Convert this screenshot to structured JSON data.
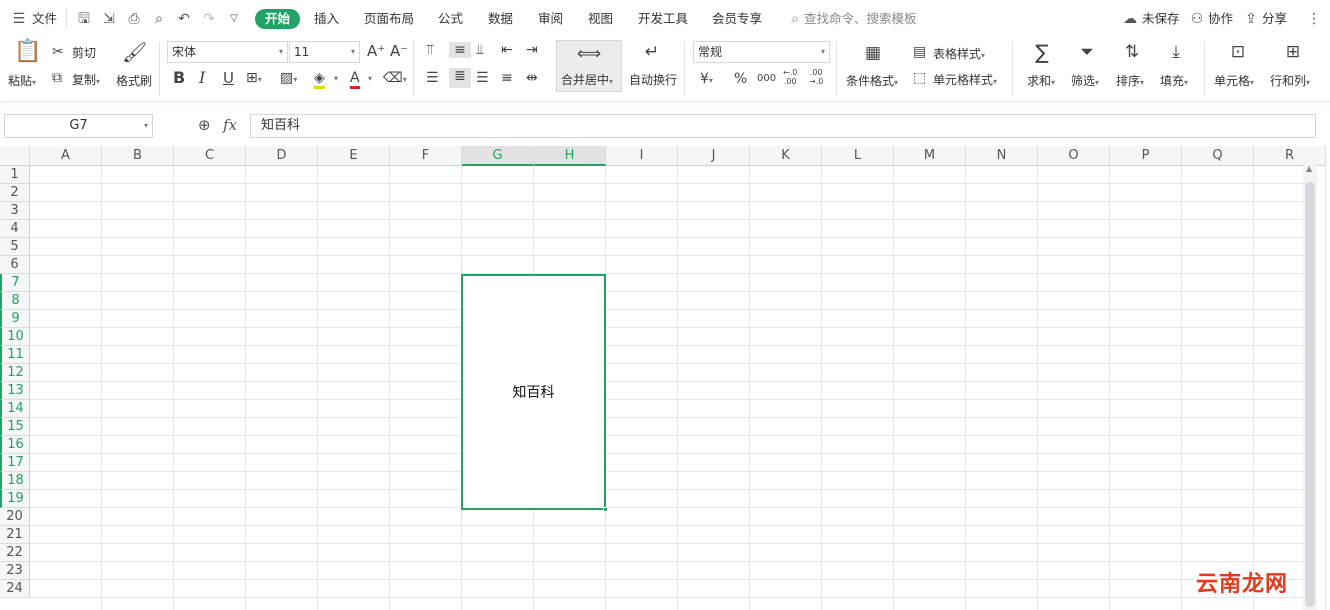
{
  "menubar": {
    "file_label": "文件",
    "tabs": [
      "开始",
      "插入",
      "页面布局",
      "公式",
      "数据",
      "审阅",
      "视图",
      "开发工具",
      "会员专享"
    ],
    "search_placeholder": "查找命令、搜索模板",
    "unsaved_label": "未保存",
    "collab_label": "协作",
    "share_label": "分享"
  },
  "ribbon": {
    "paste": "粘贴",
    "cut": "剪切",
    "copy": "复制",
    "format_painter": "格式刷",
    "font_name": "宋体",
    "font_size": "11",
    "merge_center": "合并居中",
    "wrap_text": "自动换行",
    "number_format": "常规",
    "conditional_format": "条件格式",
    "table_style": "表格样式",
    "cell_style": "单元格样式",
    "sum": "求和",
    "filter": "筛选",
    "sort": "排序",
    "fill": "填充",
    "cell": "单元格",
    "row_col": "行和列",
    "currency_symbol": "¥",
    "percent_symbol": "%",
    "thousands_symbol": "000",
    "inc_decimal": "←.0\n.00",
    "dec_decimal": ".00\n→.0"
  },
  "formula_bar": {
    "name_box": "G7",
    "fx_label": "fx",
    "content": "知百科"
  },
  "sheet": {
    "columns": [
      "A",
      "B",
      "C",
      "D",
      "E",
      "F",
      "G",
      "H",
      "I",
      "J",
      "K",
      "L",
      "M",
      "N",
      "O",
      "P",
      "Q",
      "R"
    ],
    "rows": [
      "1",
      "2",
      "3",
      "4",
      "5",
      "6",
      "7",
      "8",
      "9",
      "10",
      "11",
      "12",
      "13",
      "14",
      "15",
      "16",
      "17",
      "18",
      "19",
      "20",
      "21",
      "22",
      "23",
      "24"
    ],
    "selected_cell_text": "知百科",
    "accent_color": "#21a366"
  },
  "watermark": "云南龙网"
}
